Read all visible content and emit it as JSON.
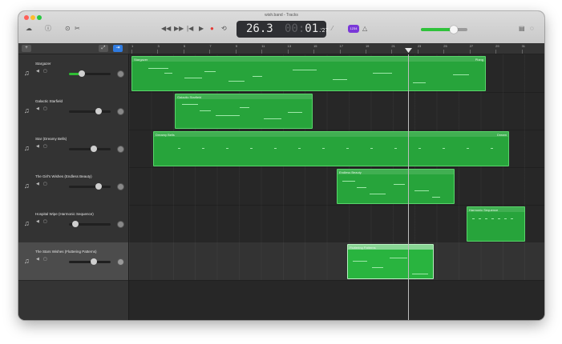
{
  "window": {
    "title": "wish.band - Tracks"
  },
  "toolbar": {
    "left_icons": [
      "library-icon",
      "help-icon",
      "smart-controls-icon",
      "editors-icon"
    ],
    "transport_icons": [
      "rewind-icon",
      "fast-forward-icon",
      "go-to-start-icon",
      "play-icon",
      "record-icon",
      "cycle-icon"
    ],
    "lcd": {
      "bar": "26.3",
      "time_minutes_dim": "00:",
      "time_seconds": "01",
      "time_fraction": ".27"
    },
    "badge": "1234",
    "master_volume": 0.7,
    "right_icons": [
      "notepad-icon",
      "loops-icon"
    ],
    "colors": {
      "accent_green": "#2fc23a",
      "badge_purple": "#7a38d8",
      "record_red": "#e53935"
    }
  },
  "ruler": {
    "marks": [
      "1",
      "3",
      "5",
      "7",
      "9",
      "11",
      "13",
      "15",
      "17",
      "19",
      "21",
      "23",
      "25",
      "27",
      "29",
      "31"
    ]
  },
  "tracks": [
    {
      "name": "Stargazer",
      "volume": 0.3,
      "selected": false,
      "regions": [
        {
          "name": "Stargazer",
          "end_label": "Plang"
        }
      ]
    },
    {
      "name": "Galactic Starfield",
      "volume": 0.72,
      "selected": false,
      "regions": [
        {
          "name": "Galactic Starfield",
          "end_label": ""
        }
      ]
    },
    {
      "name": "Star (Dreamy Bells)",
      "volume": 0.6,
      "selected": false,
      "regions": [
        {
          "name": "Dreamy Bells",
          "end_label": "Dream"
        }
      ]
    },
    {
      "name": "The Girl's Wishes (Endless Beauty)",
      "volume": 0.72,
      "selected": false,
      "regions": [
        {
          "name": "Endless Beauty",
          "end_label": ""
        }
      ]
    },
    {
      "name": "Hospital Wipe (Harmonic Sequence)",
      "volume": 0.15,
      "selected": false,
      "regions": [
        {
          "name": "Harmonic Sequence",
          "end_label": ""
        }
      ]
    },
    {
      "name": "The Stars Wishes (Fluttering Patterns)",
      "volume": 0.6,
      "selected": true,
      "regions": [
        {
          "name": "Fluttering Patterns",
          "end_label": ""
        }
      ]
    }
  ]
}
